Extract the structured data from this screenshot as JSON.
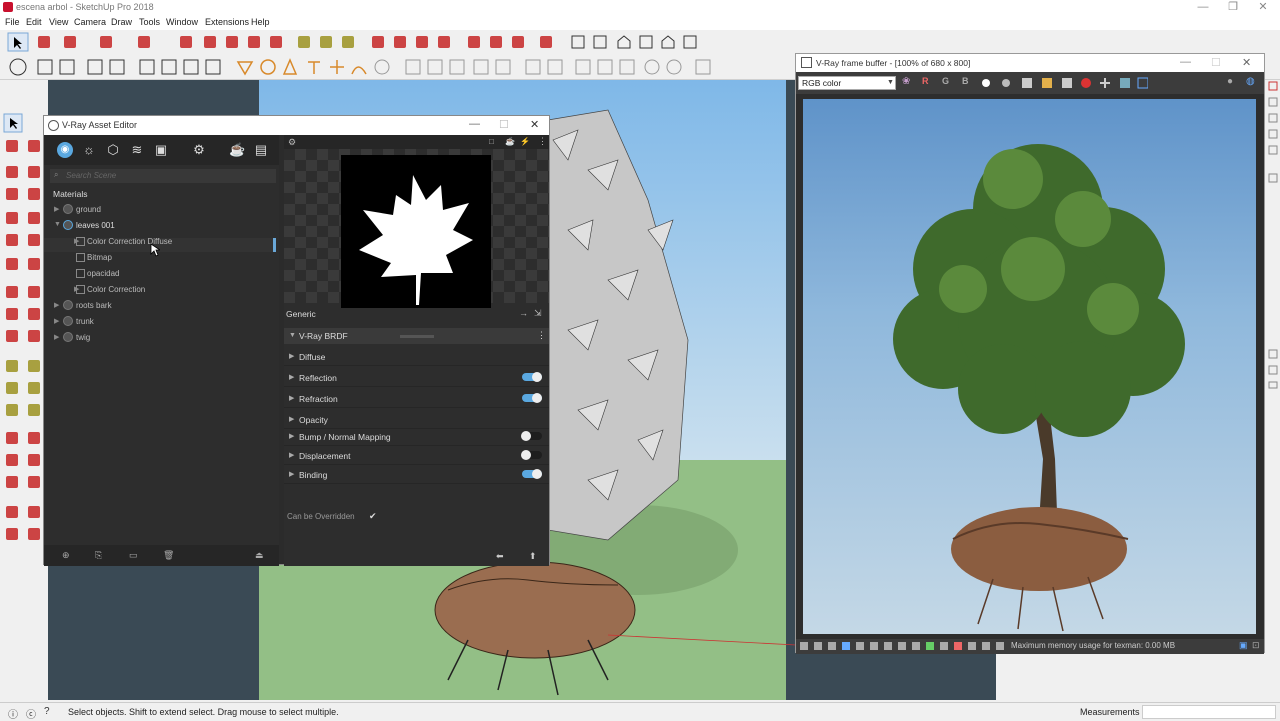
{
  "app": {
    "window_title": "escena arbol - SketchUp Pro 2018"
  },
  "menu": [
    "File",
    "Edit",
    "View",
    "Camera",
    "Draw",
    "Tools",
    "Window",
    "Extensions",
    "Help"
  ],
  "status": {
    "hint": "Select objects. Shift to extend select. Drag mouse to select multiple.",
    "measurements_label": "Measurements"
  },
  "asset_editor": {
    "title": "V-Ray Asset Editor",
    "search_placeholder": "Search Scene",
    "materials_heading": "Materials",
    "materials": [
      {
        "name": "ground"
      },
      {
        "name": "leaves 001",
        "children": [
          "Color Correction Diffuse",
          "Bitmap",
          "opacidad",
          "Color Correction"
        ]
      },
      {
        "name": "roots bark"
      },
      {
        "name": "trunk"
      },
      {
        "name": "twig"
      }
    ],
    "generic_label": "Generic",
    "brdf_label": "V-Ray BRDF",
    "rollouts": [
      {
        "label": "Diffuse",
        "toggle": null
      },
      {
        "label": "Reflection",
        "toggle": true
      },
      {
        "label": "Refraction",
        "toggle": true
      },
      {
        "label": "Opacity",
        "toggle": null
      },
      {
        "label": "Bump / Normal Mapping",
        "toggle": false
      },
      {
        "label": "Displacement",
        "toggle": false
      },
      {
        "label": "Binding",
        "toggle": true
      }
    ],
    "override_label": "Can be Overridden",
    "override_checked": true
  },
  "frame_buffer": {
    "title": "V-Ray frame buffer - [100% of 680 x 800]",
    "channel": "RGB color",
    "channel_buttons": [
      "R",
      "G",
      "B"
    ],
    "status": "Maximum memory usage for texman: 0.00 MB"
  },
  "colors": {
    "accent": "#5aa8e0",
    "toggle_on": "#5aa8e0",
    "toggle_off": "#1e1e1e"
  }
}
